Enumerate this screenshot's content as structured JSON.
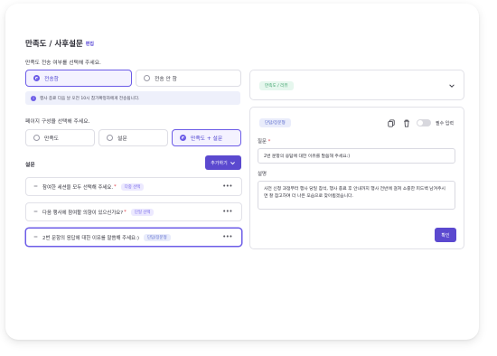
{
  "page": {
    "title": "만족도 / 사후설문",
    "edit_label": "편집"
  },
  "send_section": {
    "label": "만족도 전송 여부를 선택해 주세요.",
    "options": [
      "전송함",
      "전송 안 함"
    ],
    "selected": "전송함",
    "notice": "행사 종료 다음 날 오전 10시 참가확정자에게 전송됩니다."
  },
  "layout_section": {
    "label": "페이지 구성을 선택해 주세요.",
    "options": [
      "만족도",
      "설문",
      "만족도 + 설문"
    ],
    "selected": "만족도 + 설문"
  },
  "survey": {
    "label": "설문",
    "add_button": "추가하기",
    "questions": [
      {
        "text": "참여한 세션을 모두 선택해 주세요.",
        "required_mark": "*",
        "type": "다중 선택"
      },
      {
        "text": "다음 행사에 참여할 의향이 있으신가요?",
        "required_mark": "*",
        "type": "단일 선택"
      },
      {
        "text": "2번 문항의 응답에 대한 이유를 말씀해 주세요:)",
        "required_mark": "",
        "type": "단답/장문형"
      }
    ]
  },
  "right_panel": {
    "collapsed_chip": "만족도 / 리뷰",
    "type_chip": "단답/장문형",
    "required_label": "필수 입력",
    "required_on": false,
    "question_label": "질문",
    "question_required_mark": "*",
    "question_value": "2번 문항의 응답에 대한 이유를 말씀해 주세요:)",
    "description_label": "설명",
    "description_value": "사전 신청 과정부터 행사 당일 참석, 행사 종료 후 안내까지 행사 전반에 걸쳐 소중한 피드백 남겨주시면 잘 참고하여 더 나은 모습으로 찾아뵙겠습니다.",
    "confirm_button": "확인"
  },
  "colors": {
    "accent": "#5b49cf",
    "accent_light": "#f4f2ff",
    "tag_bg": "#ece9ff",
    "required": "#e0414b",
    "green_chip": "#3aa169"
  },
  "icons": {
    "collapse": "chevron-down-icon",
    "copy": "copy-icon",
    "delete": "trash-icon",
    "drag": "drag-handle-icon",
    "more": "more-horizontal-icon",
    "info": "info-icon"
  }
}
